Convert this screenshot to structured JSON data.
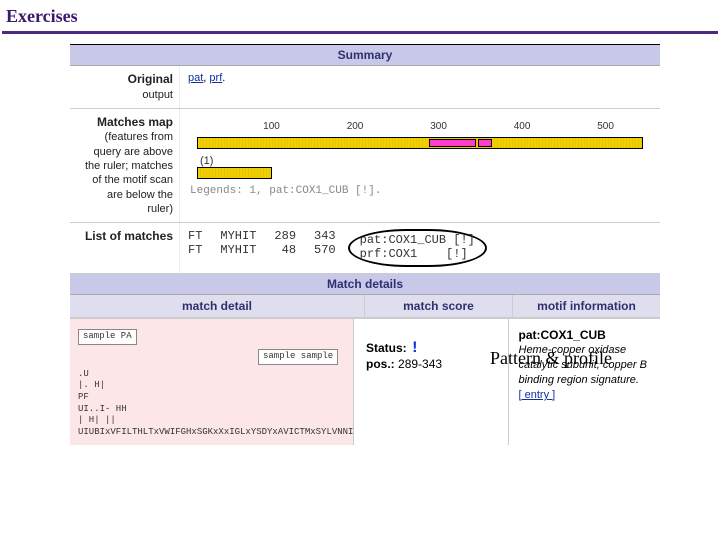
{
  "header": {
    "title": "Exercises"
  },
  "summary": {
    "heading": "Summary",
    "original_output": {
      "label_bold": "Original",
      "label_rest": "output",
      "link1": "pat",
      "link2": "prf",
      "suffix": "."
    },
    "matches_map": {
      "label_bold": "Matches map",
      "label_rest": "(features from query are above the ruler; matches of the motif scan are below the ruler)",
      "ticks": {
        "t1": "100",
        "t2": "200",
        "t3": "300",
        "t4": "400",
        "t5": "500"
      },
      "legend_one": "(1)",
      "legend_text": "Legends: 1, pat:COX1_CUB [!]."
    },
    "list_of_matches": {
      "label_bold": "List of matches",
      "col1": "FT\nFT",
      "col2": "MYHIT\nMYHIT",
      "col3": "289\n 48",
      "col4": "343\n570",
      "col5": "pat:COX1_CUB [!]\nprf:COX1    [!]"
    }
  },
  "annotation": {
    "text": "Pattern & profile"
  },
  "match_details": {
    "heading": "Match details",
    "columns": {
      "c1": "match detail",
      "c2": "match score",
      "c3": "motif information"
    }
  },
  "detail": {
    "left": {
      "box1": "sample\nPA",
      "box2": "sample\nsample",
      "line1": ".U",
      "line2": "|. H|",
      "line3": " PF",
      "line4": "UI..I-                                                    HH",
      "line5": "   | H|                                                    ||",
      "line6": "UIUBIxVFILTHLTxVWIFGHxSGKxXxIGLxYSDYxAVICTMxSYLVNNI"
    },
    "mid": {
      "status_label": "Status:",
      "status_mark": "!",
      "pos_label": "pos.:",
      "pos_value": "289-343"
    },
    "right": {
      "pat": "pat:COX1_CUB",
      "desc": "Heme-copper oxidase catalytic subunit, copper B binding region signature.",
      "entry": "[ entry ]"
    }
  }
}
